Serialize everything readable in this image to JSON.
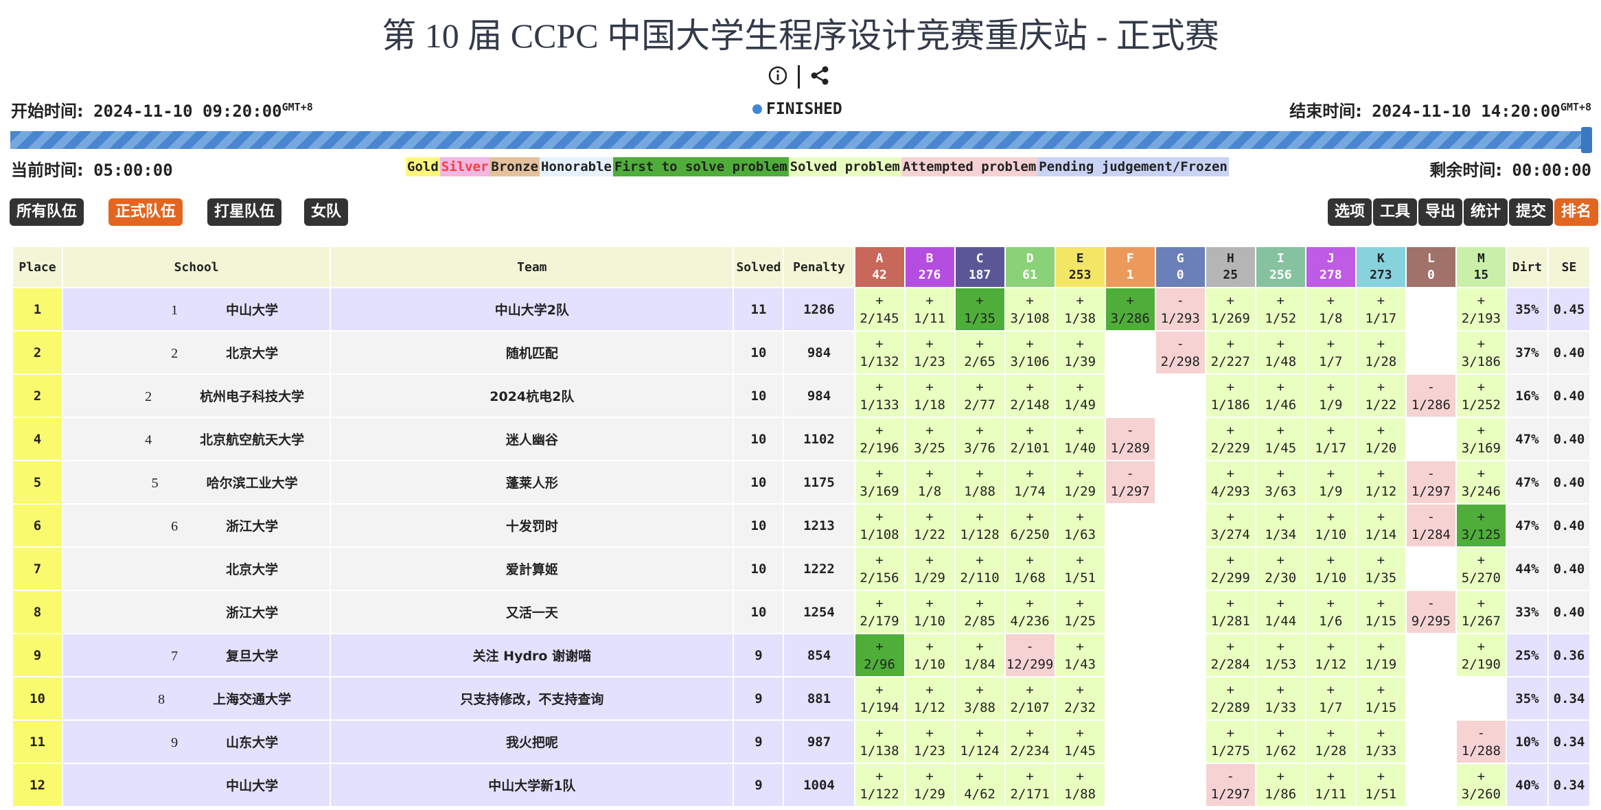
{
  "title": "第 10 届 CCPC 中国大学生程序设计竞赛重庆站 - 正式赛",
  "icons": [
    "info-icon",
    "share-icon"
  ],
  "start": {
    "label": "开始时间:",
    "value": "2024-11-10 09:20:00",
    "tz": "GMT+8"
  },
  "end": {
    "label": "结束时间:",
    "value": "2024-11-10 14:20:00",
    "tz": "GMT+8"
  },
  "status": "FINISHED",
  "progress": 1.0,
  "elapsed": {
    "label": "当前时间:",
    "value": "05:00:00"
  },
  "remaining": {
    "label": "剩余时间:",
    "value": "00:00:00"
  },
  "legend": [
    {
      "label": "Gold",
      "color": "#fff779"
    },
    {
      "label": "Silver",
      "color": "#f2b7e3",
      "text_color": "#ff3a3a"
    },
    {
      "label": "Bronze",
      "color": "#e4c19c"
    },
    {
      "label": "Honorable",
      "color": "#e6f2ff"
    },
    {
      "label": "First to solve problem",
      "color": "#4fae3a"
    },
    {
      "label": "Solved problem",
      "color": "#e8ffc0"
    },
    {
      "label": "Attempted problem",
      "color": "#f6d2d2"
    },
    {
      "label": "Pending judgement/Frozen",
      "color": "#c9d3f5"
    }
  ],
  "filters": [
    {
      "label": "所有队伍",
      "active": false
    },
    {
      "label": "正式队伍",
      "active": true
    },
    {
      "label": "打星队伍",
      "active": false
    },
    {
      "label": "女队",
      "active": false
    }
  ],
  "toolbar": [
    {
      "label": "选项",
      "active": false
    },
    {
      "label": "工具",
      "active": false
    },
    {
      "label": "导出",
      "active": false
    },
    {
      "label": "统计",
      "active": false
    },
    {
      "label": "提交",
      "active": false
    },
    {
      "label": "排名",
      "active": true
    }
  ],
  "columns": {
    "place": "Place",
    "school": "School",
    "team": "Team",
    "solved": "Solved",
    "penalty": "Penalty",
    "dirt": "Dirt",
    "se": "SE"
  },
  "problems": [
    {
      "id": "A",
      "count": "42",
      "color": "#c8685a"
    },
    {
      "id": "B",
      "count": "276",
      "color": "#b54ee0"
    },
    {
      "id": "C",
      "count": "187",
      "color": "#5b5797"
    },
    {
      "id": "D",
      "count": "61",
      "color": "#8ad177"
    },
    {
      "id": "E",
      "count": "253",
      "color": "#f4e665",
      "text_color": "#222"
    },
    {
      "id": "F",
      "count": "1",
      "color": "#ec9a5c"
    },
    {
      "id": "G",
      "count": "0",
      "color": "#6b7fb8"
    },
    {
      "id": "H",
      "count": "25",
      "color": "#b5b5b5",
      "text_color": "#222"
    },
    {
      "id": "I",
      "count": "256",
      "color": "#86c1a0"
    },
    {
      "id": "J",
      "count": "278",
      "color": "#c05be6"
    },
    {
      "id": "K",
      "count": "273",
      "color": "#86d3de",
      "text_color": "#222"
    },
    {
      "id": "L",
      "count": "0",
      "color": "#a0726a"
    },
    {
      "id": "M",
      "count": "15",
      "color": "#c9f0a9",
      "text_color": "#222"
    }
  ],
  "rows": [
    {
      "place": "1",
      "rank": "1",
      "school": "中山大学",
      "team": "中山大学2队",
      "solved": "11",
      "penalty": "1286",
      "dirt": "35%",
      "se": "0.45",
      "bg": "#e3e1fd",
      "cells": [
        [
          "+",
          "2/145",
          "ac"
        ],
        [
          "+",
          "1/11",
          "ac"
        ],
        [
          "+",
          "1/35",
          "fb"
        ],
        [
          "+",
          "3/108",
          "ac"
        ],
        [
          "+",
          "1/38",
          "ac"
        ],
        [
          "+",
          "3/286",
          "fb"
        ],
        [
          "-",
          "1/293",
          "rj"
        ],
        [
          "+",
          "1/269",
          "ac"
        ],
        [
          "+",
          "1/52",
          "ac"
        ],
        [
          "+",
          "1/8",
          "ac"
        ],
        [
          "+",
          "1/17",
          "ac"
        ],
        [
          "",
          "",
          "none"
        ],
        [
          "+",
          "2/193",
          "ac"
        ]
      ]
    },
    {
      "place": "2",
      "rank": "2",
      "school": "北京大学",
      "team": "随机匹配",
      "solved": "10",
      "penalty": "984",
      "dirt": "37%",
      "se": "0.40",
      "bg": "#f3f3f3",
      "cells": [
        [
          "+",
          "1/132",
          "ac"
        ],
        [
          "+",
          "1/23",
          "ac"
        ],
        [
          "+",
          "2/65",
          "ac"
        ],
        [
          "+",
          "3/106",
          "ac"
        ],
        [
          "+",
          "1/39",
          "ac"
        ],
        [
          "",
          "",
          "none"
        ],
        [
          "-",
          "2/298",
          "rj"
        ],
        [
          "+",
          "2/227",
          "ac"
        ],
        [
          "+",
          "1/48",
          "ac"
        ],
        [
          "+",
          "1/7",
          "ac"
        ],
        [
          "+",
          "1/28",
          "ac"
        ],
        [
          "",
          "",
          "none"
        ],
        [
          "+",
          "3/186",
          "ac"
        ]
      ]
    },
    {
      "place": "2",
      "rank": "2",
      "school": "杭州电子科技大学",
      "team": "2024杭电2队",
      "solved": "10",
      "penalty": "984",
      "dirt": "16%",
      "se": "0.40",
      "bg": "#f3f3f3",
      "cells": [
        [
          "+",
          "1/133",
          "ac"
        ],
        [
          "+",
          "1/18",
          "ac"
        ],
        [
          "+",
          "2/77",
          "ac"
        ],
        [
          "+",
          "2/148",
          "ac"
        ],
        [
          "+",
          "1/49",
          "ac"
        ],
        [
          "",
          "",
          "none"
        ],
        [
          "",
          "",
          "none"
        ],
        [
          "+",
          "1/186",
          "ac"
        ],
        [
          "+",
          "1/46",
          "ac"
        ],
        [
          "+",
          "1/9",
          "ac"
        ],
        [
          "+",
          "1/22",
          "ac"
        ],
        [
          "-",
          "1/286",
          "rj"
        ],
        [
          "+",
          "1/252",
          "ac"
        ]
      ]
    },
    {
      "place": "4",
      "rank": "4",
      "school": "北京航空航天大学",
      "team": "迷人幽谷",
      "solved": "10",
      "penalty": "1102",
      "dirt": "47%",
      "se": "0.40",
      "bg": "#f3f3f3",
      "cells": [
        [
          "+",
          "2/196",
          "ac"
        ],
        [
          "+",
          "3/25",
          "ac"
        ],
        [
          "+",
          "3/76",
          "ac"
        ],
        [
          "+",
          "2/101",
          "ac"
        ],
        [
          "+",
          "1/40",
          "ac"
        ],
        [
          "-",
          "1/289",
          "rj"
        ],
        [
          "",
          "",
          "none"
        ],
        [
          "+",
          "2/229",
          "ac"
        ],
        [
          "+",
          "1/45",
          "ac"
        ],
        [
          "+",
          "1/17",
          "ac"
        ],
        [
          "+",
          "1/20",
          "ac"
        ],
        [
          "",
          "",
          "none"
        ],
        [
          "+",
          "3/169",
          "ac"
        ]
      ]
    },
    {
      "place": "5",
      "rank": "5",
      "school": "哈尔滨工业大学",
      "team": "蓬莱人形",
      "solved": "10",
      "penalty": "1175",
      "dirt": "47%",
      "se": "0.40",
      "bg": "#f3f3f3",
      "cells": [
        [
          "+",
          "3/169",
          "ac"
        ],
        [
          "+",
          "1/8",
          "ac"
        ],
        [
          "+",
          "1/88",
          "ac"
        ],
        [
          "+",
          "1/74",
          "ac"
        ],
        [
          "+",
          "1/29",
          "ac"
        ],
        [
          "-",
          "1/297",
          "rj"
        ],
        [
          "",
          "",
          "none"
        ],
        [
          "+",
          "4/293",
          "ac"
        ],
        [
          "+",
          "3/63",
          "ac"
        ],
        [
          "+",
          "1/9",
          "ac"
        ],
        [
          "+",
          "1/12",
          "ac"
        ],
        [
          "-",
          "1/297",
          "rj"
        ],
        [
          "+",
          "3/246",
          "ac"
        ]
      ]
    },
    {
      "place": "6",
      "rank": "6",
      "school": "浙江大学",
      "team": "十发罚时",
      "solved": "10",
      "penalty": "1213",
      "dirt": "47%",
      "se": "0.40",
      "bg": "#f3f3f3",
      "cells": [
        [
          "+",
          "1/108",
          "ac"
        ],
        [
          "+",
          "1/22",
          "ac"
        ],
        [
          "+",
          "1/128",
          "ac"
        ],
        [
          "+",
          "6/250",
          "ac"
        ],
        [
          "+",
          "1/63",
          "ac"
        ],
        [
          "",
          "",
          "none"
        ],
        [
          "",
          "",
          "none"
        ],
        [
          "+",
          "3/274",
          "ac"
        ],
        [
          "+",
          "1/34",
          "ac"
        ],
        [
          "+",
          "1/10",
          "ac"
        ],
        [
          "+",
          "1/14",
          "ac"
        ],
        [
          "-",
          "1/284",
          "rj"
        ],
        [
          "+",
          "3/125",
          "fb"
        ]
      ]
    },
    {
      "place": "7",
      "rank": "",
      "school": "北京大学",
      "team": "爱計算姬",
      "solved": "10",
      "penalty": "1222",
      "dirt": "44%",
      "se": "0.40",
      "bg": "#f3f3f3",
      "cells": [
        [
          "+",
          "2/156",
          "ac"
        ],
        [
          "+",
          "1/29",
          "ac"
        ],
        [
          "+",
          "2/110",
          "ac"
        ],
        [
          "+",
          "1/68",
          "ac"
        ],
        [
          "+",
          "1/51",
          "ac"
        ],
        [
          "",
          "",
          "none"
        ],
        [
          "",
          "",
          "none"
        ],
        [
          "+",
          "2/299",
          "ac"
        ],
        [
          "+",
          "2/30",
          "ac"
        ],
        [
          "+",
          "1/10",
          "ac"
        ],
        [
          "+",
          "1/35",
          "ac"
        ],
        [
          "",
          "",
          "none"
        ],
        [
          "+",
          "5/270",
          "ac"
        ]
      ]
    },
    {
      "place": "8",
      "rank": "",
      "school": "浙江大学",
      "team": "又活一天",
      "solved": "10",
      "penalty": "1254",
      "dirt": "33%",
      "se": "0.40",
      "bg": "#f3f3f3",
      "cells": [
        [
          "+",
          "2/179",
          "ac"
        ],
        [
          "+",
          "1/10",
          "ac"
        ],
        [
          "+",
          "2/85",
          "ac"
        ],
        [
          "+",
          "4/236",
          "ac"
        ],
        [
          "+",
          "1/25",
          "ac"
        ],
        [
          "",
          "",
          "none"
        ],
        [
          "",
          "",
          "none"
        ],
        [
          "+",
          "1/281",
          "ac"
        ],
        [
          "+",
          "1/44",
          "ac"
        ],
        [
          "+",
          "1/6",
          "ac"
        ],
        [
          "+",
          "1/15",
          "ac"
        ],
        [
          "-",
          "9/295",
          "rj"
        ],
        [
          "+",
          "1/267",
          "ac"
        ]
      ]
    },
    {
      "place": "9",
      "rank": "7",
      "school": "复旦大学",
      "team": "关注 Hydro 谢谢喵",
      "solved": "9",
      "penalty": "854",
      "dirt": "25%",
      "se": "0.36",
      "bg": "#e3e1fd",
      "cells": [
        [
          "+",
          "2/96",
          "fb"
        ],
        [
          "+",
          "1/10",
          "ac"
        ],
        [
          "+",
          "1/84",
          "ac"
        ],
        [
          "-",
          "12/299",
          "rj"
        ],
        [
          "+",
          "1/43",
          "ac"
        ],
        [
          "",
          "",
          "none"
        ],
        [
          "",
          "",
          "none"
        ],
        [
          "+",
          "2/284",
          "ac"
        ],
        [
          "+",
          "1/53",
          "ac"
        ],
        [
          "+",
          "1/12",
          "ac"
        ],
        [
          "+",
          "1/19",
          "ac"
        ],
        [
          "",
          "",
          "none"
        ],
        [
          "+",
          "2/190",
          "ac"
        ]
      ]
    },
    {
      "place": "10",
      "rank": "8",
      "school": "上海交通大学",
      "team": "只支持修改，不支持查询",
      "solved": "9",
      "penalty": "881",
      "dirt": "35%",
      "se": "0.34",
      "bg": "#e3e1fd",
      "cells": [
        [
          "+",
          "1/194",
          "ac"
        ],
        [
          "+",
          "1/12",
          "ac"
        ],
        [
          "+",
          "3/88",
          "ac"
        ],
        [
          "+",
          "2/107",
          "ac"
        ],
        [
          "+",
          "2/32",
          "ac"
        ],
        [
          "",
          "",
          "none"
        ],
        [
          "",
          "",
          "none"
        ],
        [
          "+",
          "2/289",
          "ac"
        ],
        [
          "+",
          "1/33",
          "ac"
        ],
        [
          "+",
          "1/7",
          "ac"
        ],
        [
          "+",
          "1/15",
          "ac"
        ],
        [
          "",
          "",
          "none"
        ],
        [
          "",
          "",
          "none"
        ]
      ]
    },
    {
      "place": "11",
      "rank": "9",
      "school": "山东大学",
      "team": "我火把呢",
      "solved": "9",
      "penalty": "987",
      "dirt": "10%",
      "se": "0.34",
      "bg": "#e3e1fd",
      "cells": [
        [
          "+",
          "1/138",
          "ac"
        ],
        [
          "+",
          "1/23",
          "ac"
        ],
        [
          "+",
          "1/124",
          "ac"
        ],
        [
          "+",
          "2/234",
          "ac"
        ],
        [
          "+",
          "1/45",
          "ac"
        ],
        [
          "",
          "",
          "none"
        ],
        [
          "",
          "",
          "none"
        ],
        [
          "+",
          "1/275",
          "ac"
        ],
        [
          "+",
          "1/62",
          "ac"
        ],
        [
          "+",
          "1/28",
          "ac"
        ],
        [
          "+",
          "1/33",
          "ac"
        ],
        [
          "",
          "",
          "none"
        ],
        [
          "-",
          "1/288",
          "rj"
        ]
      ]
    },
    {
      "place": "12",
      "rank": "",
      "school": "中山大学",
      "team": "中山大学新1队",
      "solved": "9",
      "penalty": "1004",
      "dirt": "40%",
      "se": "0.34",
      "bg": "#e3e1fd",
      "cells": [
        [
          "+",
          "1/122",
          "ac"
        ],
        [
          "+",
          "1/29",
          "ac"
        ],
        [
          "+",
          "4/62",
          "ac"
        ],
        [
          "+",
          "2/171",
          "ac"
        ],
        [
          "+",
          "1/88",
          "ac"
        ],
        [
          "",
          "",
          "none"
        ],
        [
          "",
          "",
          "none"
        ],
        [
          "-",
          "1/297",
          "rj"
        ],
        [
          "+",
          "1/86",
          "ac"
        ],
        [
          "+",
          "1/11",
          "ac"
        ],
        [
          "+",
          "1/51",
          "ac"
        ],
        [
          "",
          "",
          "none"
        ],
        [
          "+",
          "3/260",
          "ac"
        ]
      ]
    }
  ]
}
